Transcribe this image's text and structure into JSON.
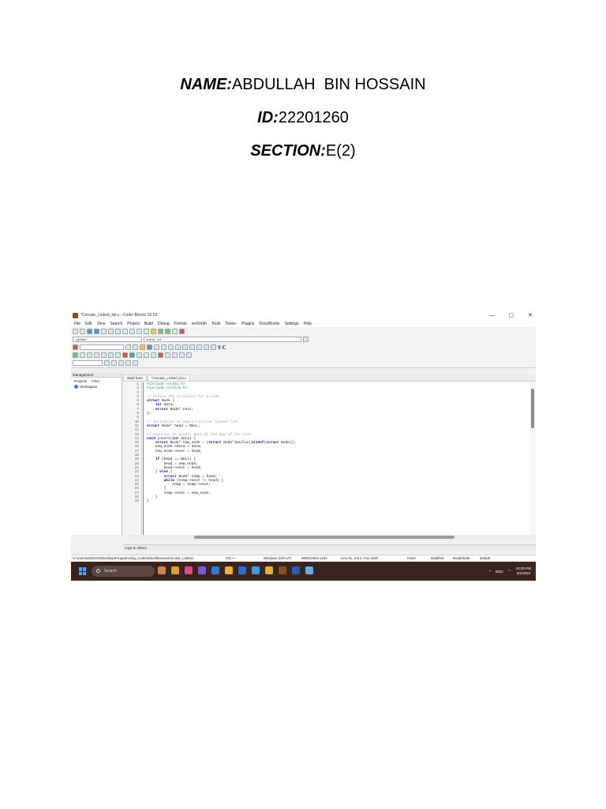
{
  "header": {
    "name_label": "NAME:",
    "name_value": "ABDULLAH  BIN HOSSAIN",
    "id_label": "ID:",
    "id_value": "22201260",
    "section_label": "SECTION:",
    "section_value": "E(2)"
  },
  "screenshot": {
    "window_title": "*Circular_Linked_list.c - Code::Blocks 20.03",
    "window_controls": [
      "—",
      "▢",
      "✕"
    ],
    "menu": [
      "File",
      "Edit",
      "View",
      "Search",
      "Project",
      "Build",
      "Debug",
      "Fortran",
      "wxSmith",
      "Tools",
      "Tools+",
      "Plugins",
      "DoxyBlocks",
      "Settings",
      "Help"
    ],
    "scope_combo": "<global>",
    "function_combo": "main() : int",
    "sc_label": "S C",
    "management": {
      "title": "Management",
      "tabs": [
        "Projects",
        "Files"
      ],
      "workspace": "Workspace"
    },
    "editor_tabs": [
      "Start here",
      "*Circular_Linked_list.c"
    ],
    "line_numbers": [
      "1",
      "2",
      "3",
      "4",
      "5",
      "6",
      "7",
      "8",
      "9",
      "10",
      "11",
      "12",
      "13",
      "14",
      "15",
      "16",
      "17",
      "18",
      "19",
      "20",
      "21",
      "22",
      "23",
      "24",
      "25",
      "26",
      "27",
      "28",
      "29"
    ],
    "code_lines": [
      "#include <stdio.h>",
      "#include <stdlib.h>",
      "",
      "// Define the structure for a node",
      "struct Node {",
      "    int data;",
      "    struct Node* next;",
      "};",
      "",
      "// Initialize an empty circular linked list",
      "struct Node* head = NULL;",
      "",
      "// Function to insert data at the end of the list",
      "void insert(int data) {",
      "    struct Node* new_node = (struct Node*)malloc(sizeof(struct Node));",
      "    new_node->data = data;",
      "    new_node->next = head;",
      "",
      "    if (head == NULL) {",
      "        head = new_node;",
      "        head->next = head;",
      "    } else {",
      "        struct Node* temp = head;",
      "        while (temp->next != head) {",
      "            temp = temp->next;",
      "        }",
      "        temp->next = new_node;",
      "    }",
      "}"
    ],
    "logs_label": "Logs & others",
    "status": {
      "path": "C:\\Users\\LENOVO\\Desktop\\Programming_Code\\miscellaneous\\Circular_Linked...",
      "language": "C/C++",
      "eol": "Windows (CR+LF)",
      "encoding": "WINDOWS-1252",
      "position": "Line 81, Col 4, Pos 1920",
      "mode": "Insert",
      "modified": "Modified",
      "access": "Read/Write",
      "profile": "default"
    },
    "taskbar": {
      "search_placeholder": "Search",
      "lang": "ENG",
      "time": "10:20 PM",
      "date": "4/1/2024"
    }
  }
}
